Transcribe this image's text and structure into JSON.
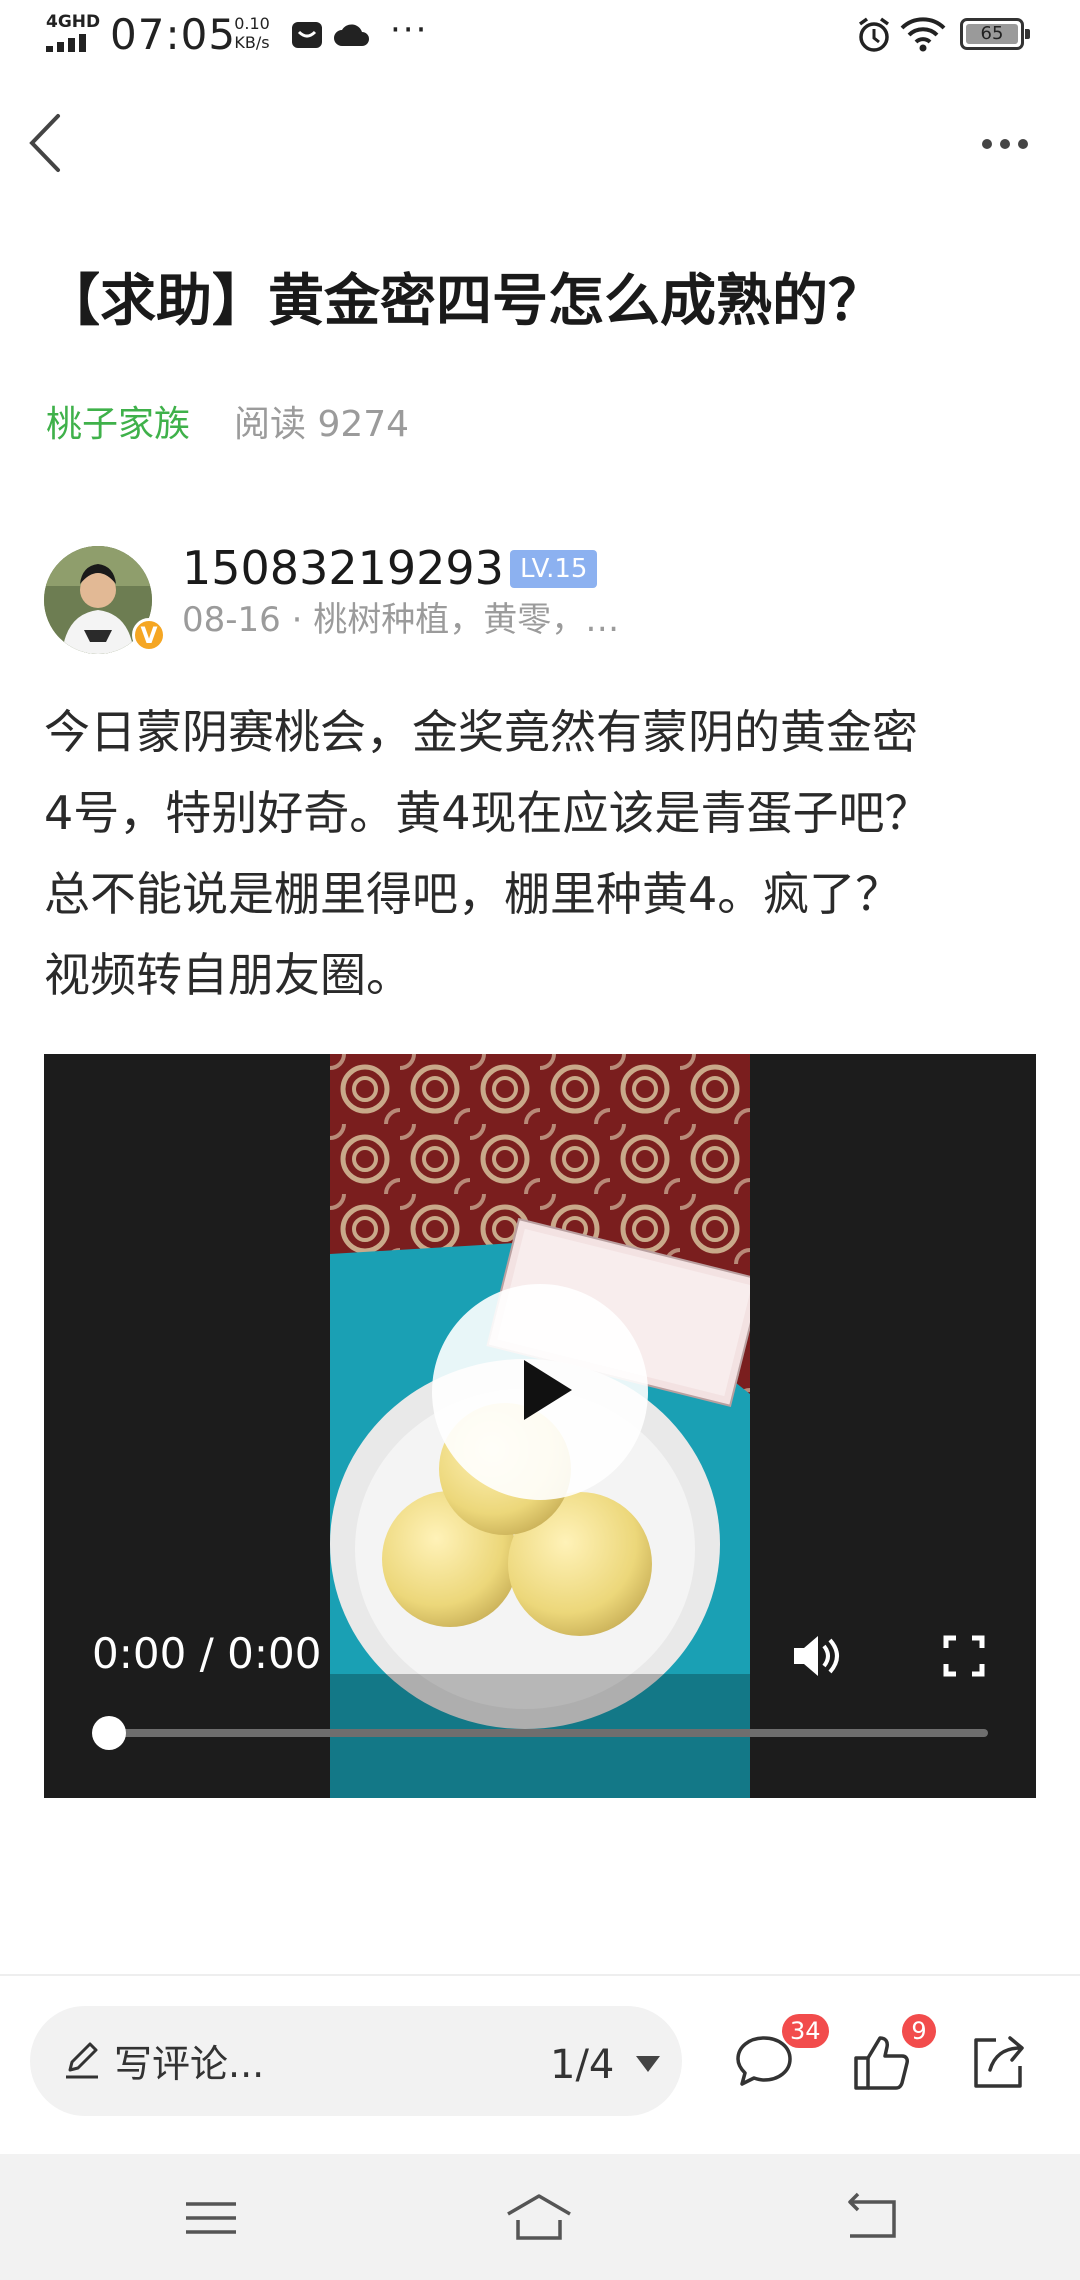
{
  "status_bar": {
    "network": "4GHD",
    "time": "07:05",
    "speed_value": "0.10",
    "speed_unit": "KB/s",
    "more": "···",
    "battery": "65"
  },
  "header": {
    "back_icon": "chevron-left-icon",
    "more_icon": "more-horizontal-icon"
  },
  "post": {
    "title": "【求助】黄金密四号怎么成熟的？",
    "forum": "桃子家族",
    "reads": "阅读 9274",
    "author": {
      "name": "15083219293",
      "level": "LV.15",
      "verified_badge": "V",
      "meta": "08-16 · 桃树种植，黄零，…"
    },
    "content_lines": [
      "今日蒙阴赛桃会，金奖竟然有蒙阴的黄金密",
      "4号，特别好奇。黄4现在应该是青蛋子吧？",
      "总不能说是棚里得吧，棚里种黄4。疯了？",
      "视频转自朋友圈。"
    ]
  },
  "video": {
    "time": "0:00 / 0:00",
    "progress": 0,
    "volume_icon": "volume-icon",
    "fullscreen_icon": "fullscreen-icon",
    "play_icon": "play-icon"
  },
  "action_bar": {
    "comment_placeholder": "写评论...",
    "page": "1/4",
    "comments_count": "34",
    "likes_count": "9"
  },
  "nav_bar": {
    "menu_icon": "menu-icon",
    "home_icon": "home-icon",
    "back_icon": "back-icon"
  },
  "colors": {
    "accent_green": "#3fb14a",
    "level_badge": "#8cb1f0",
    "count_badge": "#f24c4c",
    "verified": "#f5a623"
  }
}
